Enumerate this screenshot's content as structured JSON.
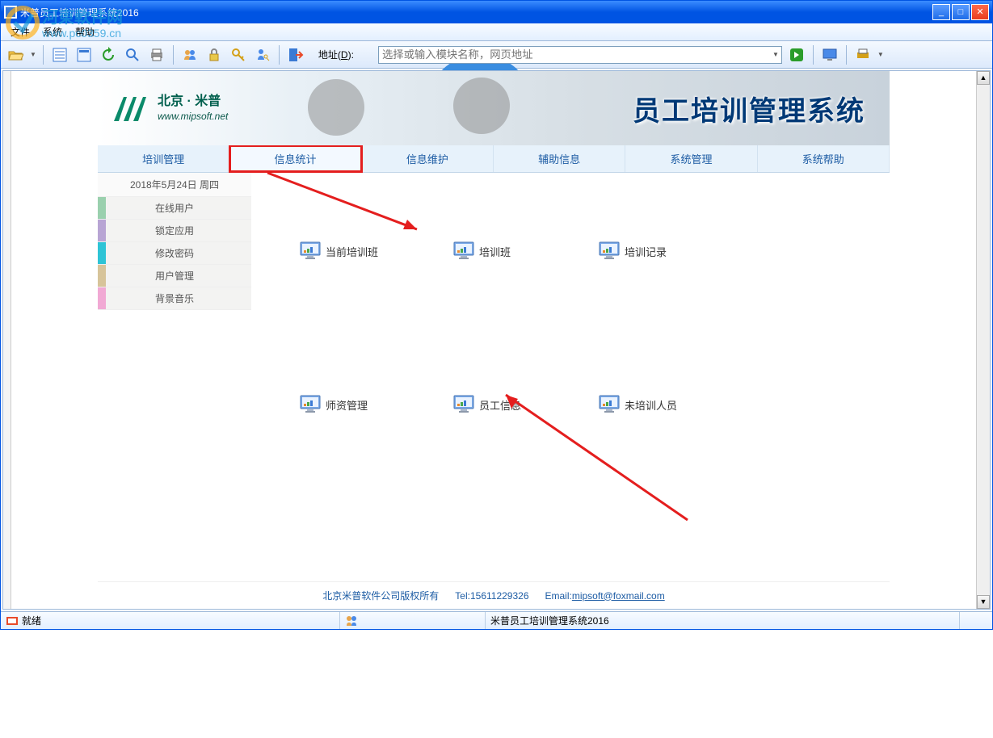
{
  "window": {
    "title": "米普员工培训管理系统2016"
  },
  "menubar": {
    "file": "文件",
    "system": "系统",
    "help": "帮助"
  },
  "watermark": {
    "text1": "河東軟件网",
    "text2": "www.pc0359.cn"
  },
  "toolbar": {
    "address_label": "地址(D):",
    "address_placeholder": "选择或输入模块名称，网页地址"
  },
  "banner": {
    "logo_cn": "北京 · 米普",
    "logo_url": "www.mipsoft.net",
    "title": "员工培训管理系统"
  },
  "nav_tabs": [
    "培训管理",
    "信息统计",
    "信息维护",
    "辅助信息",
    "系统管理",
    "系统帮助"
  ],
  "sidebar": {
    "date": "2018年5月24日  周四",
    "items": [
      "在线用户",
      "锁定应用",
      "修改密码",
      "用户管理",
      "背景音乐"
    ]
  },
  "grid": {
    "r1c1": "当前培训班",
    "r1c2": "培训班",
    "r1c3": "培训记录",
    "r2c1": "师资管理",
    "r2c2": "员工信息",
    "r2c3": "未培训人员"
  },
  "footer": {
    "copyright": "北京米普软件公司版权所有",
    "tel": "Tel:15611229326",
    "email_label": "Email:",
    "email": "mipsoft@foxmail.com"
  },
  "statusbar": {
    "ready": "就绪",
    "app": "米普员工培训管理系统2016"
  }
}
